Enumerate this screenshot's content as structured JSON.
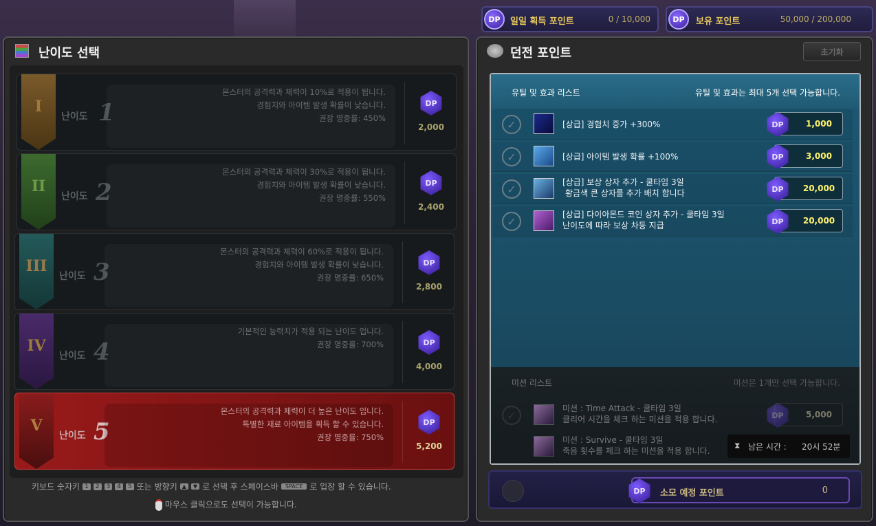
{
  "top": {
    "daily": {
      "label": "일일 획득 포인트",
      "value": "0 / 10,000"
    },
    "owned": {
      "label": "보유 포인트",
      "value": "50,000 / 200,000"
    },
    "dp": "DP"
  },
  "left": {
    "title": "난이도 선택",
    "rows": [
      {
        "roman": "I",
        "label": "난이도",
        "num": "1",
        "desc": [
          "몬스터의 공격력과 체력이 10%로 적용이 됩니다.",
          "경험치와 아이템 발생 확률이 낮습니다.",
          "권장 명중률: 450%"
        ],
        "cost": "2,000"
      },
      {
        "roman": "II",
        "label": "난이도",
        "num": "2",
        "desc": [
          "몬스터의 공격력과 체력이 30%로 적용이 됩니다.",
          "경험치와 아이템 발생 확률이 낮습니다.",
          "권장 명중률: 550%"
        ],
        "cost": "2,400"
      },
      {
        "roman": "III",
        "label": "난이도",
        "num": "3",
        "desc": [
          "몬스터의 공격력과 체력이 60%로 적용이 됩니다.",
          "경험치와 아이템 발생 확률이 낮습니다.",
          "권장 명중률: 650%"
        ],
        "cost": "2,800"
      },
      {
        "roman": "IV",
        "label": "난이도",
        "num": "4",
        "desc": [
          "기본적인 능력치가 적용 되는 난이도 입니다.",
          "권장 명중률: 700%",
          ""
        ],
        "cost": "4,000"
      },
      {
        "roman": "V",
        "label": "난이도",
        "num": "5",
        "desc": [
          "몬스터의 공격력과 체력이 더 높은 난이도 입니다.",
          "특별한 재료 아이템을 획득 할 수 있습니다.",
          "권장 명중률: 750%"
        ],
        "cost": "5,200"
      }
    ],
    "help1_a": "키보드 숫자키",
    "keys": [
      "1",
      "2",
      "3",
      "4",
      "5"
    ],
    "help1_b": "또는 방향키",
    "arrows": [
      "▲",
      "▼"
    ],
    "help1_c": "로 선택 후 스페이스바",
    "space": "SPACE",
    "help1_d": "로 입장 할 수 있습니다.",
    "help2": "마우스 클릭으로도 선택이 가능합니다."
  },
  "right": {
    "title": "던전 포인트",
    "reset": "초기화",
    "list_title": "유틸 및 효과 리스트",
    "list_note": "유틸 및 효과는 최대 5개 선택 가능합니다.",
    "items": [
      {
        "line1": "[상급] 경험치 증가 +300%",
        "line2": "",
        "price": "1,000",
        "icon": "exp-icon"
      },
      {
        "line1": "[상급] 아이템 발생 확률 +100%",
        "line2": "",
        "price": "3,000",
        "icon": "item-drop-icon"
      },
      {
        "line1": "[상급] 보상 상자 추가 - 쿨타임 3일",
        "line2": "황금색 큰 상자를 추가 배치 합니다",
        "price": "20,000",
        "icon": "reward-chest-icon"
      },
      {
        "line1": "[상급] 다이아몬드 코인 상자 추가 - 쿨타임 3일",
        "line2": "난이도에 따라 보상 차등 지급",
        "price": "20,000",
        "icon": "diamond-coin-icon"
      }
    ],
    "mission_title": "미션 리스트",
    "mission_note": "미션은 1개만 선택 가능합니다.",
    "missions": [
      {
        "line1": "미션 : Time Attack  - 쿨타임 3일",
        "line2": "클리어 시간을 체크 하는 미션을 적용 합니다.",
        "price": "5,000"
      },
      {
        "line1": "미션 : Survive  - 쿨타임 3일",
        "line2": "죽음 횟수를 체크 하는 미션을 적용 합니다.",
        "price": ""
      }
    ],
    "remaining_label": "남은 시간 :",
    "remaining_value": "20시 52분",
    "consume_label": "소모 예정 포인트",
    "consume_value": "0"
  }
}
